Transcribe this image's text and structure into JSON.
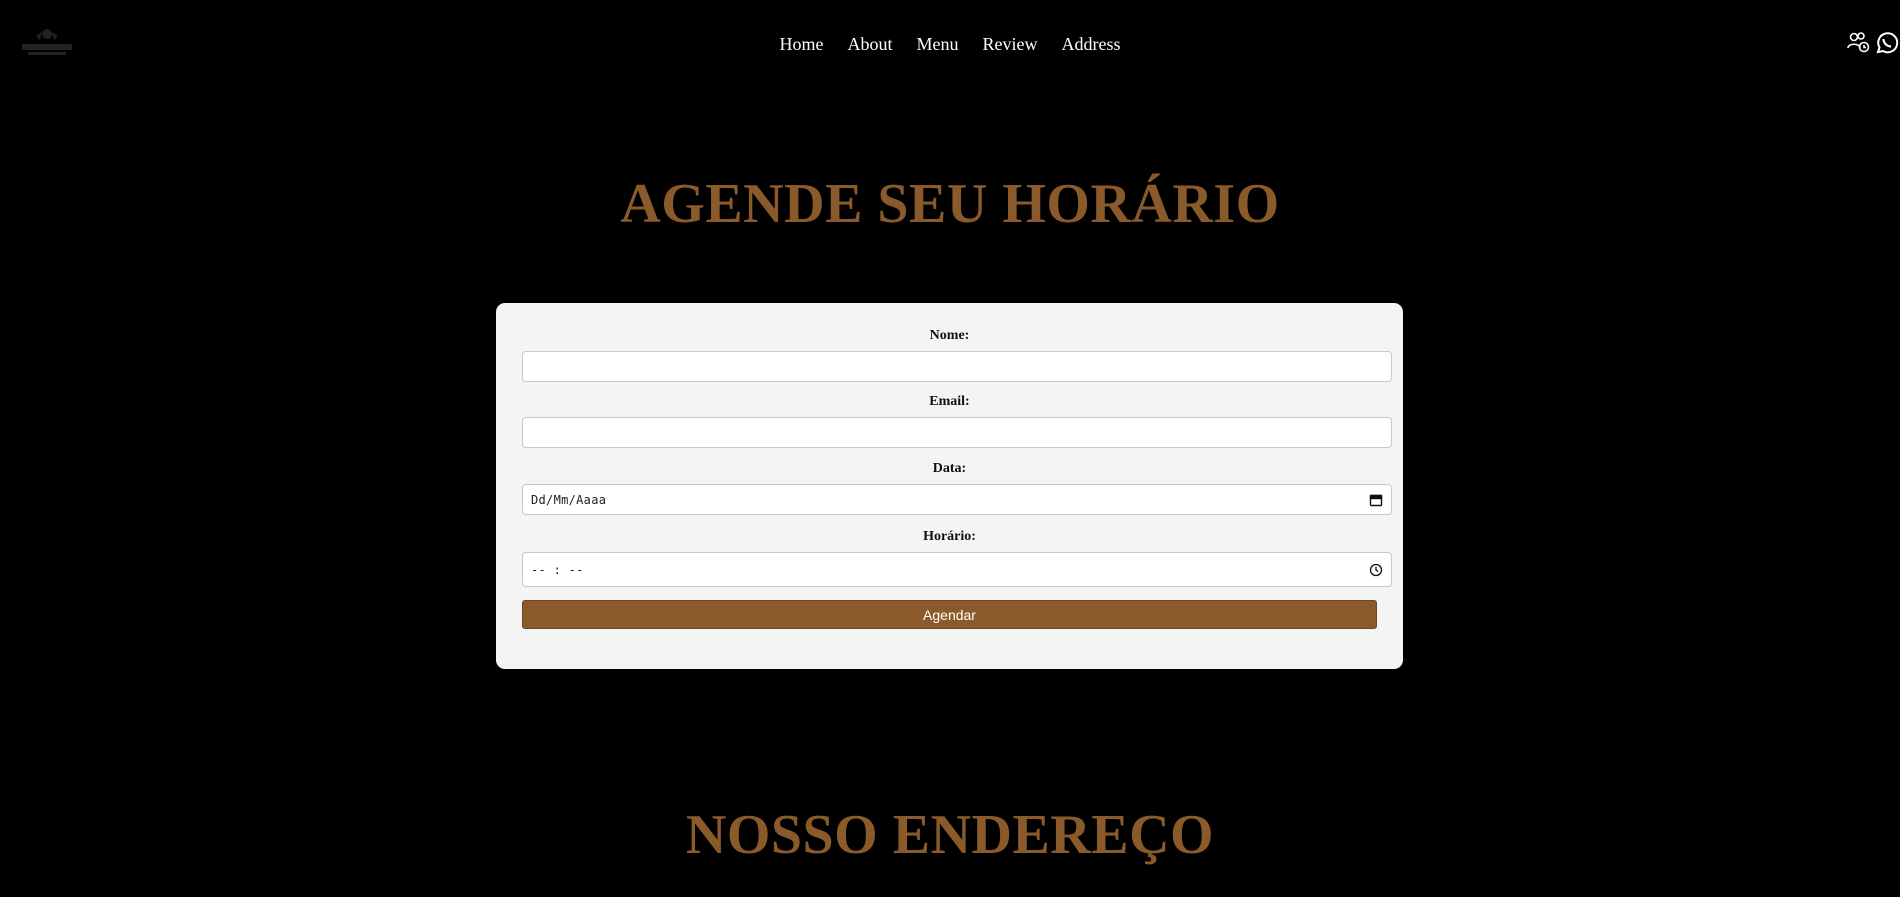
{
  "header": {
    "logo_icon": "brand-logo-icon",
    "nav": [
      {
        "label": "Home"
      },
      {
        "label": "About"
      },
      {
        "label": "Menu"
      },
      {
        "label": "Review"
      },
      {
        "label": "Address"
      }
    ],
    "icons": [
      "users-clock-icon",
      "whatsapp-icon"
    ]
  },
  "booking": {
    "title": "AGENDE SEU HORÁRIO",
    "fields": {
      "name_label": "Nome:",
      "email_label": "Email:",
      "date_label": "Data:",
      "date_placeholder": "Dd/Mm/Aaaa",
      "time_label": "Horário:",
      "time_placeholder": "-- : --"
    },
    "submit_label": "Agendar"
  },
  "address": {
    "title": "NOSSO ENDEREÇO"
  },
  "colors": {
    "accent": "#8b5a2b",
    "background": "#000000",
    "card": "#f4f4f4"
  }
}
